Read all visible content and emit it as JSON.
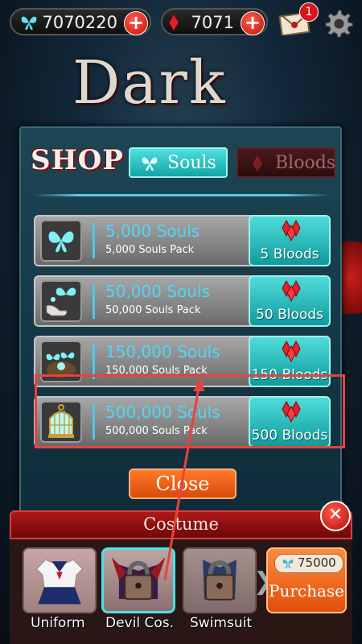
{
  "topbar": {
    "souls_amount": "7070220",
    "bloods_amount": "7071",
    "mail_badge": "1"
  },
  "background": {
    "title_line1": "Dark"
  },
  "shop": {
    "title": "SHOP",
    "tabs": [
      {
        "label": "Souls",
        "active": true
      },
      {
        "label": "Bloods",
        "active": false
      }
    ],
    "items": [
      {
        "name": "5,000 Souls",
        "desc": "5,000 Souls Pack",
        "price": "5 Bloods"
      },
      {
        "name": "50,000 Souls",
        "desc": "50,000 Souls Pack",
        "price": "50 Bloods"
      },
      {
        "name": "150,000 Souls",
        "desc": "150,000 Souls Pack",
        "price": "150 Bloods"
      },
      {
        "name": "500,000 Souls",
        "desc": "500,000 Souls Pack",
        "price": "500 Bloods"
      }
    ],
    "close_label": "Close"
  },
  "costume": {
    "title": "Costume",
    "items": [
      {
        "label": "Uniform",
        "locked": false
      },
      {
        "label": "Devil Cos.",
        "locked": true,
        "selected": true
      },
      {
        "label": "Swimsuit",
        "locked": true
      }
    ],
    "purchase_price": "75000",
    "purchase_label": "Purchase"
  },
  "colors": {
    "accent_cyan": "#2cc6c6",
    "highlight_red": "#e8423c",
    "blood_red": "#c81a1a",
    "orange": "#f06a1e"
  },
  "icons": [
    "butterfly-icon",
    "blood-drop-icon",
    "plus-icon",
    "mail-icon",
    "gear-icon",
    "lock-icon",
    "close-icon"
  ]
}
